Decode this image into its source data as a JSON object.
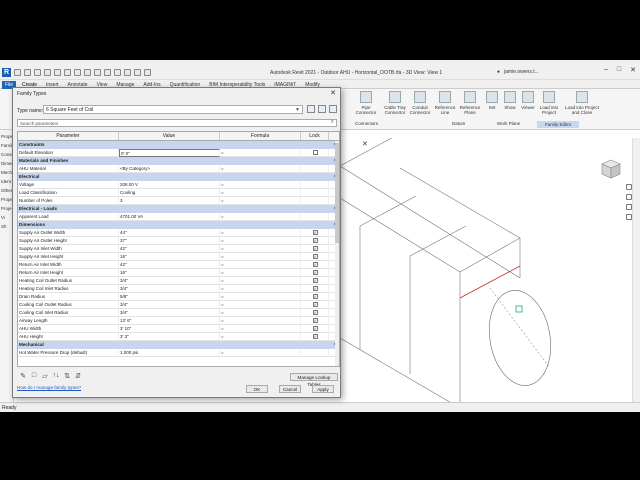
{
  "window": {
    "title": "Autodesk Revit 2021 - Outdoor AHU - Horizontal_OOTB.rfa - 3D View: View 1",
    "user": "jamie.owens.t...",
    "status": "Ready"
  },
  "ribbon": {
    "file_tab": "File",
    "tabs": [
      "Create",
      "Insert",
      "Annotate",
      "View",
      "Manage",
      "Add-Ins",
      "Quantification",
      "BIM Interoperability Tools",
      "IMAGINiT",
      "Modify"
    ],
    "active_tab": "Create",
    "buttons": [
      {
        "label": "Pipe Connector"
      },
      {
        "label": "Cable Tray Connector"
      },
      {
        "label": "Conduit Connector"
      },
      {
        "label": "Reference Line"
      },
      {
        "label": "Reference Plane"
      },
      {
        "label": "Set"
      },
      {
        "label": "Show"
      },
      {
        "label": "Viewer"
      },
      {
        "label": "Load into Project"
      },
      {
        "label": "Load into Project and Close"
      }
    ],
    "panels": [
      "Connectors",
      "Datum",
      "Work Plane",
      "Family Editor"
    ]
  },
  "left_pane": {
    "items": [
      "Propert",
      "Famil",
      "Constr",
      "Dimen",
      "Mech",
      "Ident",
      "Other",
      "Propert",
      "Proje",
      "Vi",
      "Sh"
    ]
  },
  "dialog": {
    "title": "Family Types",
    "type_name_label": "Type name:",
    "type_name_value": "6 Square Feet of Coil",
    "search_placeholder": "Search parameters",
    "columns": [
      "Parameter",
      "Value",
      "Formula",
      "Lock"
    ],
    "sections": [
      {
        "name": "Constraints",
        "rows": [
          {
            "param": "Default Elevation",
            "value": "0' 0\"",
            "formula": "=",
            "lock": "unchecked",
            "editing": true
          }
        ]
      },
      {
        "name": "Materials and Finishes",
        "rows": [
          {
            "param": "AHU Material",
            "value": "<By Category>",
            "formula": "=",
            "lock": ""
          }
        ]
      },
      {
        "name": "Electrical",
        "rows": [
          {
            "param": "Voltage",
            "value": "208.00 V",
            "formula": "=",
            "lock": ""
          },
          {
            "param": "Load Classification",
            "value": "Cooling",
            "formula": "=",
            "lock": ""
          },
          {
            "param": "Number of Poles",
            "value": "3",
            "formula": "=",
            "lock": ""
          }
        ]
      },
      {
        "name": "Electrical - Loads",
        "rows": [
          {
            "param": "Apparent Load",
            "value": "4701.00 VA",
            "formula": "=",
            "lock": ""
          }
        ]
      },
      {
        "name": "Dimensions",
        "rows": [
          {
            "param": "Supply Air Outlet Width",
            "value": "44\"",
            "formula": "=",
            "lock": "checked"
          },
          {
            "param": "Supply Air Outlet Height",
            "value": "37\"",
            "formula": "=",
            "lock": "checked"
          },
          {
            "param": "Supply Air Inlet Width",
            "value": "42\"",
            "formula": "=",
            "lock": "checked"
          },
          {
            "param": "Supply Air Inlet Height",
            "value": "16\"",
            "formula": "=",
            "lock": "checked"
          },
          {
            "param": "Return Air Inlet Width",
            "value": "42\"",
            "formula": "=",
            "lock": "checked"
          },
          {
            "param": "Return Air Inlet Height",
            "value": "16\"",
            "formula": "=",
            "lock": "checked"
          },
          {
            "param": "Heating Coil Outlet Radius",
            "value": "3/4\"",
            "formula": "=",
            "lock": "checked"
          },
          {
            "param": "Heating Coil Inlet Radius",
            "value": "3/4\"",
            "formula": "=",
            "lock": "checked"
          },
          {
            "param": "Drain Radius",
            "value": "5/8\"",
            "formula": "=",
            "lock": "checked"
          },
          {
            "param": "Cooling Coil Outlet Radius",
            "value": "3/4\"",
            "formula": "=",
            "lock": "checked"
          },
          {
            "param": "Cooling Coil Inlet Radius",
            "value": "3/4\"",
            "formula": "=",
            "lock": "checked"
          },
          {
            "param": "Airway Length",
            "value": "13' 6\"",
            "formula": "=",
            "lock": "checked"
          },
          {
            "param": "AHU Width",
            "value": "3' 10\"",
            "formula": "=",
            "lock": "checked"
          },
          {
            "param": "AHU Height",
            "value": "3' 3\"",
            "formula": "=",
            "lock": "checked"
          }
        ]
      },
      {
        "name": "Mechanical",
        "rows": [
          {
            "param": "Hot Water Pressure Drop (default)",
            "value": "1.000 psi",
            "formula": "=",
            "lock": ""
          }
        ]
      }
    ],
    "section_collapse_glyph": "˄",
    "manage_lookup_label": "Manage Lookup Tables",
    "help_link": "How do I manage family types?",
    "ok_label": "OK",
    "cancel_label": "Cancel",
    "apply_label": "Apply"
  }
}
